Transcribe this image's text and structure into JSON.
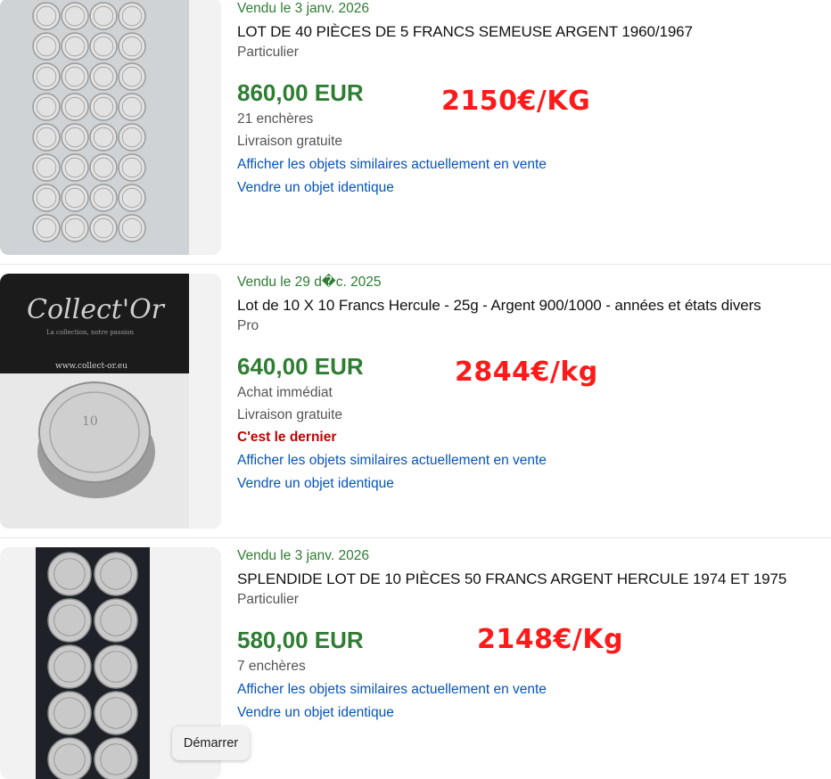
{
  "listings": [
    {
      "sold_date": "Vendu le 3 janv. 2026",
      "title": "LOT DE 40 PIÈCES DE 5 FRANCS SEMEUSE ARGENT 1960/1967",
      "seller_type": "Particulier",
      "price": "860,00 EUR",
      "details": [
        "21 enchères",
        "Livraison gratuite"
      ],
      "similar_link": "Afficher les objets similaires actuellement en vente",
      "sell_link": "Vendre un objet identique",
      "annotation": "2150€/KG"
    },
    {
      "sold_date": "Vendu le 29 d�c. 2025",
      "title": "Lot de 10 X 10 Francs Hercule - 25g - Argent 900/1000 - années et états divers",
      "seller_type": "Pro",
      "price": "640,00 EUR",
      "details": [
        "Achat immédiat",
        "Livraison gratuite"
      ],
      "last_item": "C'est le dernier",
      "similar_link": "Afficher les objets similaires actuellement en vente",
      "sell_link": "Vendre un objet identique",
      "annotation": "2844€/kg",
      "image_text": {
        "brand": "Collect'Or",
        "tagline": "La collection, notre passion",
        "url": "www.collect-or.eu"
      }
    },
    {
      "sold_date": "Vendu le 3 janv. 2026",
      "title": "SPLENDIDE LOT DE 10 PIÈCES 50 FRANCS ARGENT HERCULE 1974 ET 1975",
      "seller_type": "Particulier",
      "price": "580,00 EUR",
      "details": [
        "7 enchères"
      ],
      "similar_link": "Afficher les objets similaires actuellement en vente",
      "sell_link": "Vendre un objet identique",
      "annotation": "2148€/Kg"
    }
  ],
  "start_button": "Démarrer",
  "colors": {
    "sold": "#2e7d32",
    "price": "#2e7d32",
    "link": "#0654ba",
    "annotation": "#ff1a1a",
    "last_item": "#c00000"
  }
}
